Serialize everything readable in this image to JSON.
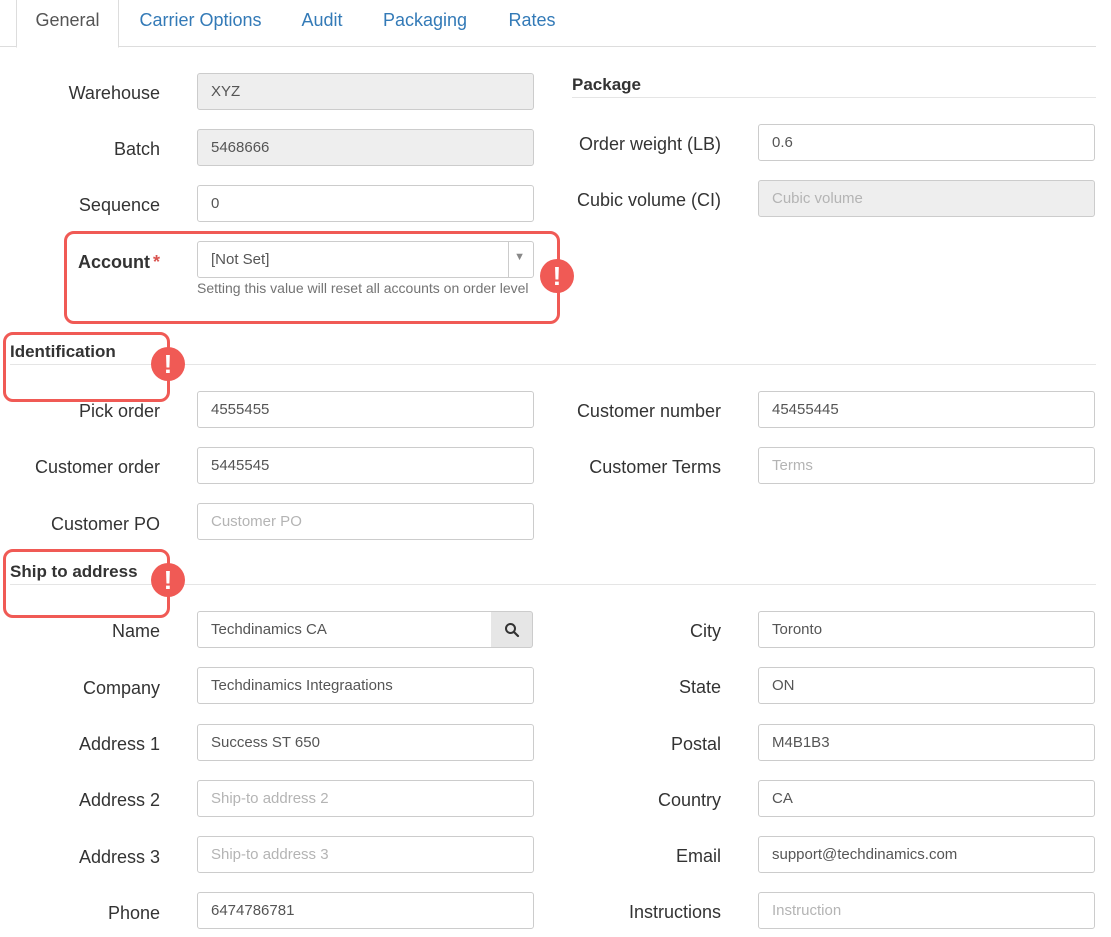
{
  "tabs": [
    {
      "label": "General",
      "active": true
    },
    {
      "label": "Carrier Options",
      "active": false
    },
    {
      "label": "Audit",
      "active": false
    },
    {
      "label": "Packaging",
      "active": false
    },
    {
      "label": "Rates",
      "active": false
    }
  ],
  "general": {
    "warehouse": {
      "label": "Warehouse",
      "value": "XYZ"
    },
    "batch": {
      "label": "Batch",
      "value": "5468666"
    },
    "sequence": {
      "label": "Sequence",
      "value": "0"
    },
    "account": {
      "label": "Account",
      "required_mark": "*",
      "value": "[Not Set]",
      "help": "Setting this value will reset all accounts on order level"
    }
  },
  "package": {
    "title": "Package",
    "order_weight": {
      "label": "Order weight (LB)",
      "value": "0.6"
    },
    "cubic_volume": {
      "label": "Cubic volume (CI)",
      "value": "",
      "placeholder": "Cubic volume"
    }
  },
  "identification": {
    "title": "Identification",
    "pick_order": {
      "label": "Pick order",
      "value": "4555455"
    },
    "customer_order": {
      "label": "Customer order",
      "value": "5445545"
    },
    "customer_po": {
      "label": "Customer PO",
      "value": "",
      "placeholder": "Customer PO"
    },
    "customer_number": {
      "label": "Customer number",
      "value": "45455445"
    },
    "customer_terms": {
      "label": "Customer Terms",
      "value": "",
      "placeholder": "Terms"
    }
  },
  "ship_to": {
    "title": "Ship to address",
    "name": {
      "label": "Name",
      "value": "Techdinamics CA"
    },
    "company": {
      "label": "Company",
      "value": "Techdinamics Integraations"
    },
    "address1": {
      "label": "Address 1",
      "value": "Success ST 650"
    },
    "address2": {
      "label": "Address 2",
      "value": "",
      "placeholder": "Ship-to address 2"
    },
    "address3": {
      "label": "Address 3",
      "value": "",
      "placeholder": "Ship-to address 3"
    },
    "phone": {
      "label": "Phone",
      "value": "6474786781"
    },
    "city": {
      "label": "City",
      "value": "Toronto"
    },
    "state": {
      "label": "State",
      "value": "ON"
    },
    "postal": {
      "label": "Postal",
      "value": "M4B1B3"
    },
    "country": {
      "label": "Country",
      "value": "CA"
    },
    "email": {
      "label": "Email",
      "value": "support@techdinamics.com"
    },
    "instructions": {
      "label": "Instructions",
      "value": "",
      "placeholder": "Instruction"
    }
  },
  "annotations": {
    "alert_glyph": "!",
    "color": "#f05a55"
  }
}
